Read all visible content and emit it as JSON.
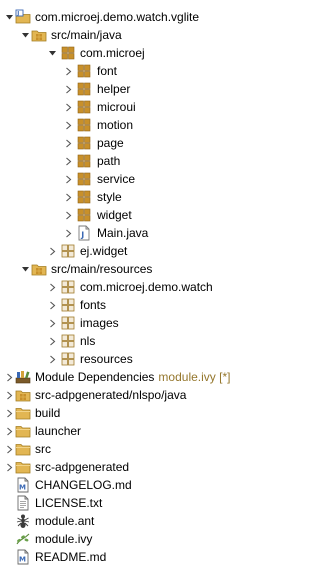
{
  "explorer": {
    "project": {
      "label": "com.microej.demo.watch.vglite"
    },
    "src_main_java": {
      "label": "src/main/java"
    },
    "pkg_root": {
      "label": "com.microej"
    },
    "packages": [
      {
        "label": "font"
      },
      {
        "label": "helper"
      },
      {
        "label": "microui"
      },
      {
        "label": "motion"
      },
      {
        "label": "page"
      },
      {
        "label": "path"
      },
      {
        "label": "service"
      },
      {
        "label": "style"
      },
      {
        "label": "widget"
      }
    ],
    "main_java": {
      "label": "Main.java"
    },
    "ej_widget": {
      "label": "ej.widget"
    },
    "src_main_resources": {
      "label": "src/main/resources"
    },
    "resource_packages": [
      {
        "label": "com.microej.demo.watch"
      },
      {
        "label": "fonts"
      },
      {
        "label": "images"
      },
      {
        "label": "nls"
      },
      {
        "label": "resources"
      }
    ],
    "module_deps": {
      "label": "Module Dependencies",
      "decoration": "module.ivy [*]"
    },
    "src_adp_nlspo": {
      "label": "src-adpgenerated/nlspo/java"
    },
    "folders": [
      {
        "label": "build"
      },
      {
        "label": "launcher"
      },
      {
        "label": "src"
      },
      {
        "label": "src-adpgenerated"
      }
    ],
    "files": {
      "changelog": {
        "label": "CHANGELOG.md"
      },
      "license": {
        "label": "LICENSE.txt"
      },
      "module_ant": {
        "label": "module.ant"
      },
      "module_ivy": {
        "label": "module.ivy"
      },
      "readme": {
        "label": "README.md"
      }
    }
  },
  "colors": {
    "package": "#c8902a",
    "folder": "#e2b653",
    "decoration": "#95772d",
    "java_blue": "#3a68b4"
  }
}
